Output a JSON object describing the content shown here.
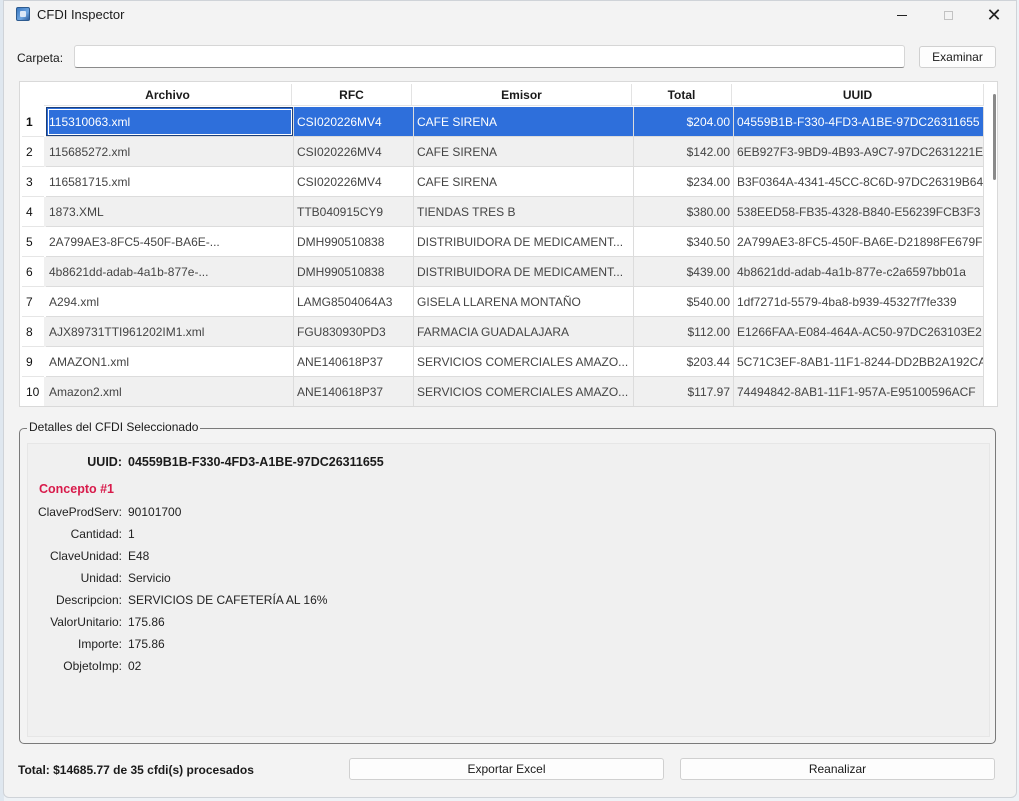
{
  "window": {
    "title": "CFDI Inspector"
  },
  "folder": {
    "label": "Carpeta:",
    "value": "",
    "browse_label": "Examinar"
  },
  "table": {
    "columns": [
      "Archivo",
      "RFC",
      "Emisor",
      "Total",
      "UUID"
    ],
    "rows": [
      {
        "n": "1",
        "archivo": "115310063.xml",
        "rfc": "CSI020226MV4",
        "emisor": "CAFE SIRENA",
        "total": "$204.00",
        "uuid": "04559B1B-F330-4FD3-A1BE-97DC26311655"
      },
      {
        "n": "2",
        "archivo": "115685272.xml",
        "rfc": "CSI020226MV4",
        "emisor": "CAFE SIRENA",
        "total": "$142.00",
        "uuid": "6EB927F3-9BD9-4B93-A9C7-97DC2631221E"
      },
      {
        "n": "3",
        "archivo": "116581715.xml",
        "rfc": "CSI020226MV4",
        "emisor": "CAFE SIRENA",
        "total": "$234.00",
        "uuid": "B3F0364A-4341-45CC-8C6D-97DC26319B64"
      },
      {
        "n": "4",
        "archivo": "1873.XML",
        "rfc": "TTB040915CY9",
        "emisor": "TIENDAS TRES B",
        "total": "$380.00",
        "uuid": "538EED58-FB35-4328-B840-E56239FCB3F3"
      },
      {
        "n": "5",
        "archivo": "2A799AE3-8FC5-450F-BA6E-...",
        "rfc": "DMH990510838",
        "emisor": "DISTRIBUIDORA DE MEDICAMENT...",
        "total": "$340.50",
        "uuid": "2A799AE3-8FC5-450F-BA6E-D21898FE679F"
      },
      {
        "n": "6",
        "archivo": "4b8621dd-adab-4a1b-877e-...",
        "rfc": "DMH990510838",
        "emisor": "DISTRIBUIDORA DE MEDICAMENT...",
        "total": "$439.00",
        "uuid": "4b8621dd-adab-4a1b-877e-c2a6597bb01a"
      },
      {
        "n": "7",
        "archivo": "A294.xml",
        "rfc": "LAMG8504064A3",
        "emisor": "GISELA LLARENA MONTAÑO",
        "total": "$540.00",
        "uuid": "1df7271d-5579-4ba8-b939-45327f7fe339"
      },
      {
        "n": "8",
        "archivo": "AJX89731TTI961202IM1.xml",
        "rfc": "FGU830930PD3",
        "emisor": "FARMACIA GUADALAJARA",
        "total": "$112.00",
        "uuid": "E1266FAA-E084-464A-AC50-97DC263103E2"
      },
      {
        "n": "9",
        "archivo": "AMAZON1.xml",
        "rfc": "ANE140618P37",
        "emisor": "SERVICIOS COMERCIALES AMAZO...",
        "total": "$203.44",
        "uuid": "5C71C3EF-8AB1-11F1-8244-DD2BB2A192CA"
      },
      {
        "n": "10",
        "archivo": "Amazon2.xml",
        "rfc": "ANE140618P37",
        "emisor": "SERVICIOS COMERCIALES AMAZO...",
        "total": "$117.97",
        "uuid": "74494842-8AB1-11F1-957A-E95100596ACF"
      }
    ]
  },
  "details": {
    "legend": "Detalles del CFDI Seleccionado",
    "uuid_label": "UUID:",
    "uuid_value": "04559B1B-F330-4FD3-A1BE-97DC26311655",
    "concept_title": "Concepto #1",
    "fields": [
      {
        "label": "ClaveProdServ:",
        "value": "90101700"
      },
      {
        "label": "Cantidad:",
        "value": "1"
      },
      {
        "label": "ClaveUnidad:",
        "value": "E48"
      },
      {
        "label": "Unidad:",
        "value": "Servicio"
      },
      {
        "label": "Descripcion:",
        "value": "SERVICIOS DE CAFETERÍA AL 16%"
      },
      {
        "label": "ValorUnitario:",
        "value": "175.86"
      },
      {
        "label": "Importe:",
        "value": "175.86"
      },
      {
        "label": "ObjetoImp:",
        "value": "02"
      }
    ]
  },
  "footer": {
    "total_text": "Total: $14685.77 de 35 cfdi(s) procesados",
    "export_label": "Exportar Excel",
    "reanalyze_label": "Reanalizar"
  },
  "colors": {
    "selection": "#2e6fdb",
    "concept": "#d81b4b"
  }
}
